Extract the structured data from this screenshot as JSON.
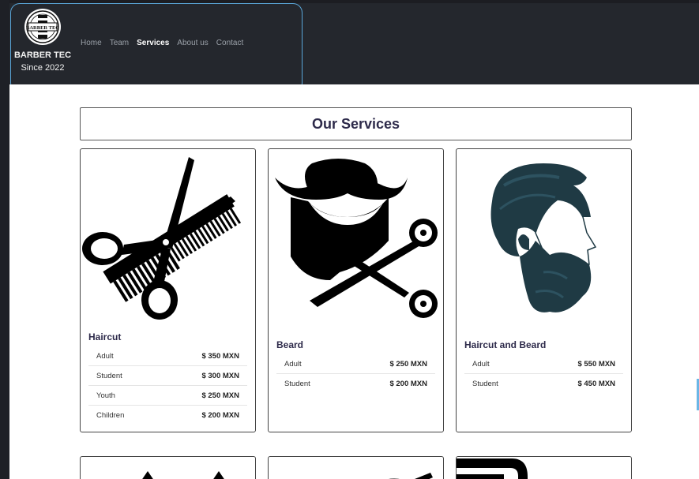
{
  "navbar": {
    "brand_name": "BARBER TEC",
    "brand_since": "Since 2022",
    "logo_text": "BARBER TEC",
    "links": [
      "Home",
      "Team",
      "Services",
      "About us",
      "Contact"
    ],
    "active": "Services"
  },
  "main": {
    "title": "Our Services",
    "cards": [
      {
        "title": "Haircut",
        "icon": "scissors-comb-icon",
        "prices": [
          {
            "label": "Adult",
            "price": "$ 350 MXN"
          },
          {
            "label": "Student",
            "price": "$ 300 MXN"
          },
          {
            "label": "Youth",
            "price": "$ 250 MXN"
          },
          {
            "label": "Children",
            "price": "$ 200 MXN"
          }
        ]
      },
      {
        "title": "Beard",
        "icon": "beard-scissors-icon",
        "prices": [
          {
            "label": "Adult",
            "price": "$ 250 MXN"
          },
          {
            "label": "Student",
            "price": "$ 200 MXN"
          }
        ]
      },
      {
        "title": "Haircut and Beard",
        "icon": "bearded-man-profile-icon",
        "prices": [
          {
            "label": "Adult",
            "price": "$ 550 MXN"
          },
          {
            "label": "Student",
            "price": "$ 450 MXN"
          }
        ]
      }
    ]
  },
  "colors": {
    "navbar_bg": "#24272d",
    "title_text": "#2d2a4a",
    "focus_ring": "#5aa6d8",
    "hair_dark": "#1f3a44"
  }
}
